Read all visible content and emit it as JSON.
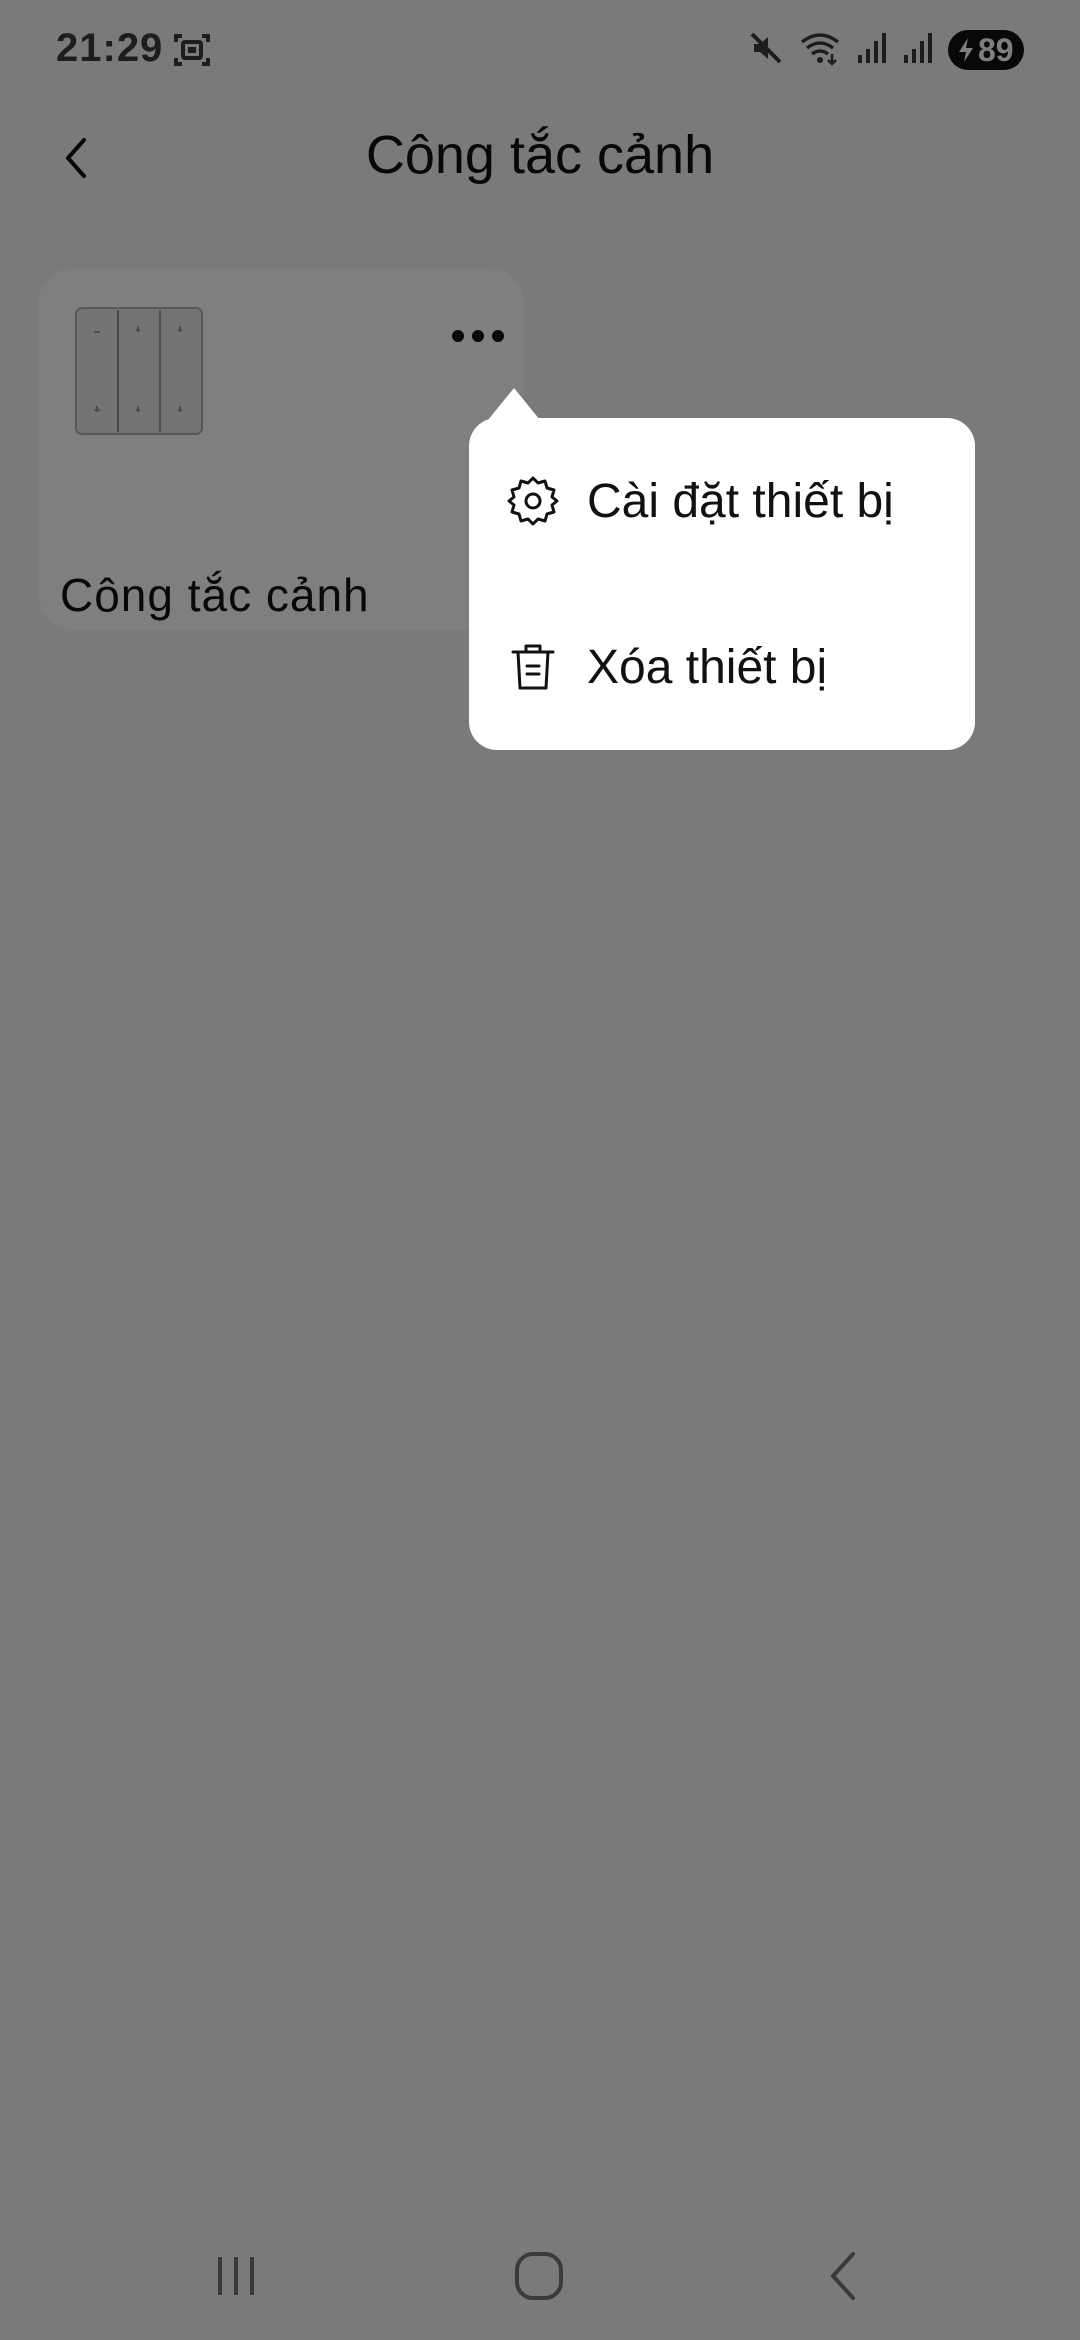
{
  "status_bar": {
    "time": "21:29",
    "battery": "89",
    "icons": [
      "screenshot-icon",
      "mute-icon",
      "wifi-icon",
      "signal-icon",
      "signal-icon",
      "battery-icon"
    ]
  },
  "header": {
    "title": "Công tắc cảnh",
    "back_icon": "chevron-left-icon"
  },
  "device_card": {
    "name": "Công tắc cảnh",
    "more_icon": "more-horizontal-icon"
  },
  "popup_menu": {
    "items": [
      {
        "label": "Cài đặt thiết bị",
        "icon": "gear-icon"
      },
      {
        "label": "Xóa thiết bị",
        "icon": "trash-icon"
      }
    ]
  },
  "nav_bar": {
    "icons": [
      "recents-icon",
      "home-icon",
      "back-icon"
    ]
  },
  "colors": {
    "page_background": "#f4f4f6",
    "card_background": "#ffffff",
    "overlay": "rgba(0,0,0,0.5)",
    "text_primary": "#111111"
  }
}
